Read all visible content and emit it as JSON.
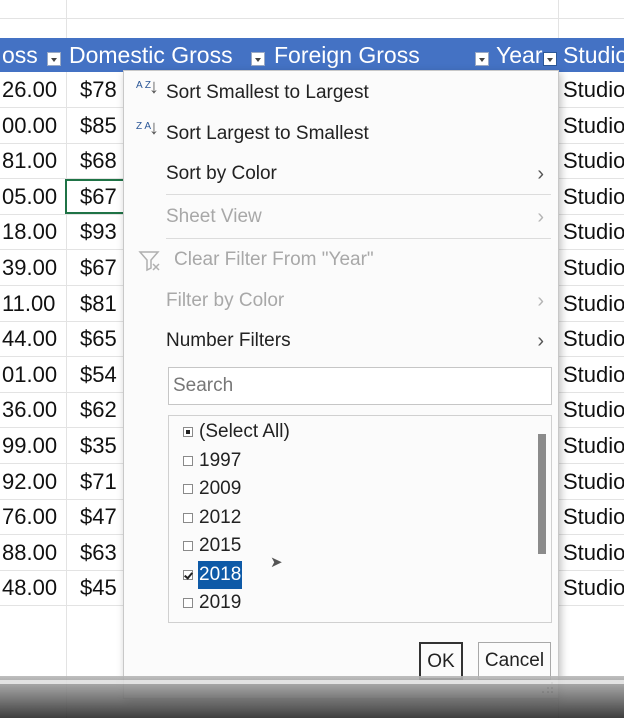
{
  "sheet": {
    "headers": [
      {
        "label": "oss",
        "has_filter": true
      },
      {
        "label": "Domestic Gross",
        "has_filter": true
      },
      {
        "label": "Foreign Gross",
        "has_filter": true
      },
      {
        "label": "Year",
        "has_filter": true
      },
      {
        "label": "Studio",
        "has_filter": false
      }
    ],
    "rows": [
      {
        "gross": "26.00",
        "domestic": "$78",
        "studio": "Studio"
      },
      {
        "gross": "00.00",
        "domestic": "$85",
        "studio": "Studio"
      },
      {
        "gross": "81.00",
        "domestic": "$68",
        "studio": "Studio"
      },
      {
        "gross": "05.00",
        "domestic": "$67",
        "studio": "Studio"
      },
      {
        "gross": "18.00",
        "domestic": "$93",
        "studio": "Studio"
      },
      {
        "gross": "39.00",
        "domestic": "$67",
        "studio": "Studio"
      },
      {
        "gross": "11.00",
        "domestic": "$81",
        "studio": "Studio"
      },
      {
        "gross": "44.00",
        "domestic": "$65",
        "studio": "Studio"
      },
      {
        "gross": "01.00",
        "domestic": "$54",
        "studio": "Studio"
      },
      {
        "gross": "36.00",
        "domestic": "$62",
        "studio": "Studio"
      },
      {
        "gross": "99.00",
        "domestic": "$35",
        "studio": "Studio"
      },
      {
        "gross": "92.00",
        "domestic": "$71",
        "studio": "Studio"
      },
      {
        "gross": "76.00",
        "domestic": "$47",
        "studio": "Studio"
      },
      {
        "gross": "88.00",
        "domestic": "$63",
        "studio": "Studio"
      },
      {
        "gross": "48.00",
        "domestic": "$45",
        "studio": "Studio"
      }
    ]
  },
  "filter_menu": {
    "sort_asc": "Sort Smallest to Largest",
    "sort_desc": "Sort Largest to Smallest",
    "sort_by_color": "Sort by Color",
    "sheet_view": "Sheet View",
    "clear_filter": "Clear Filter From \"Year\"",
    "filter_by_color": "Filter by Color",
    "number_filters": "Number Filters",
    "search_placeholder": "Search",
    "sort_asc_icon_text": "A Z",
    "sort_desc_icon_text": "Z A",
    "items": [
      {
        "label": "(Select All)",
        "state": "partial"
      },
      {
        "label": "1997",
        "state": "unchecked"
      },
      {
        "label": "2009",
        "state": "unchecked"
      },
      {
        "label": "2012",
        "state": "unchecked"
      },
      {
        "label": "2015",
        "state": "unchecked"
      },
      {
        "label": "2018",
        "state": "checked"
      },
      {
        "label": "2019",
        "state": "unchecked"
      }
    ],
    "ok_label": "OK",
    "cancel_label": "Cancel"
  },
  "colors": {
    "header_bg": "#4472c4",
    "selection_bg": "#0e5aa7",
    "cursor_highlight": "#f5f028"
  }
}
